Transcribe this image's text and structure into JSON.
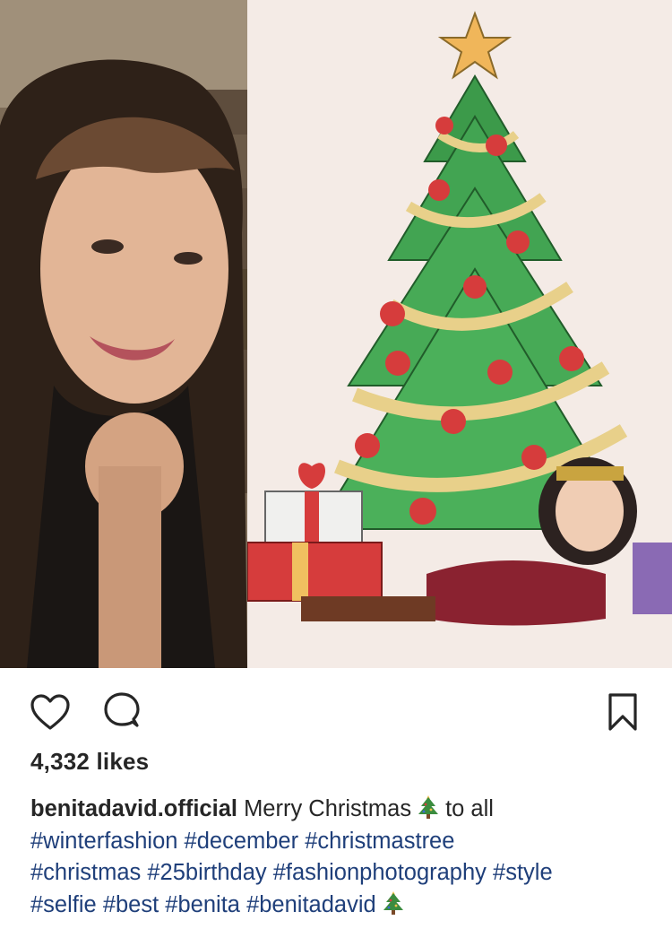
{
  "post": {
    "image": {
      "left_description": "selfie",
      "right_description": "christmas-tree-bitmoji"
    },
    "actions": {
      "like_icon": "heart-icon",
      "comment_icon": "comment-icon",
      "save_icon": "bookmark-icon"
    },
    "likes_text": "4,332 likes",
    "caption": {
      "username": "benitadavid.official",
      "text_before_emoji": "Merry Christmas",
      "emoji_1": "christmas-tree-emoji",
      "text_after_emoji": "to all",
      "hashtags": [
        "#winterfashion",
        "#december",
        "#christmastree",
        "#christmas",
        "#25birthday",
        "#fashionphotography",
        "#style",
        "#selfie",
        "#best",
        "#benita",
        "#benitadavid"
      ],
      "emoji_2": "christmas-tree-emoji"
    }
  }
}
